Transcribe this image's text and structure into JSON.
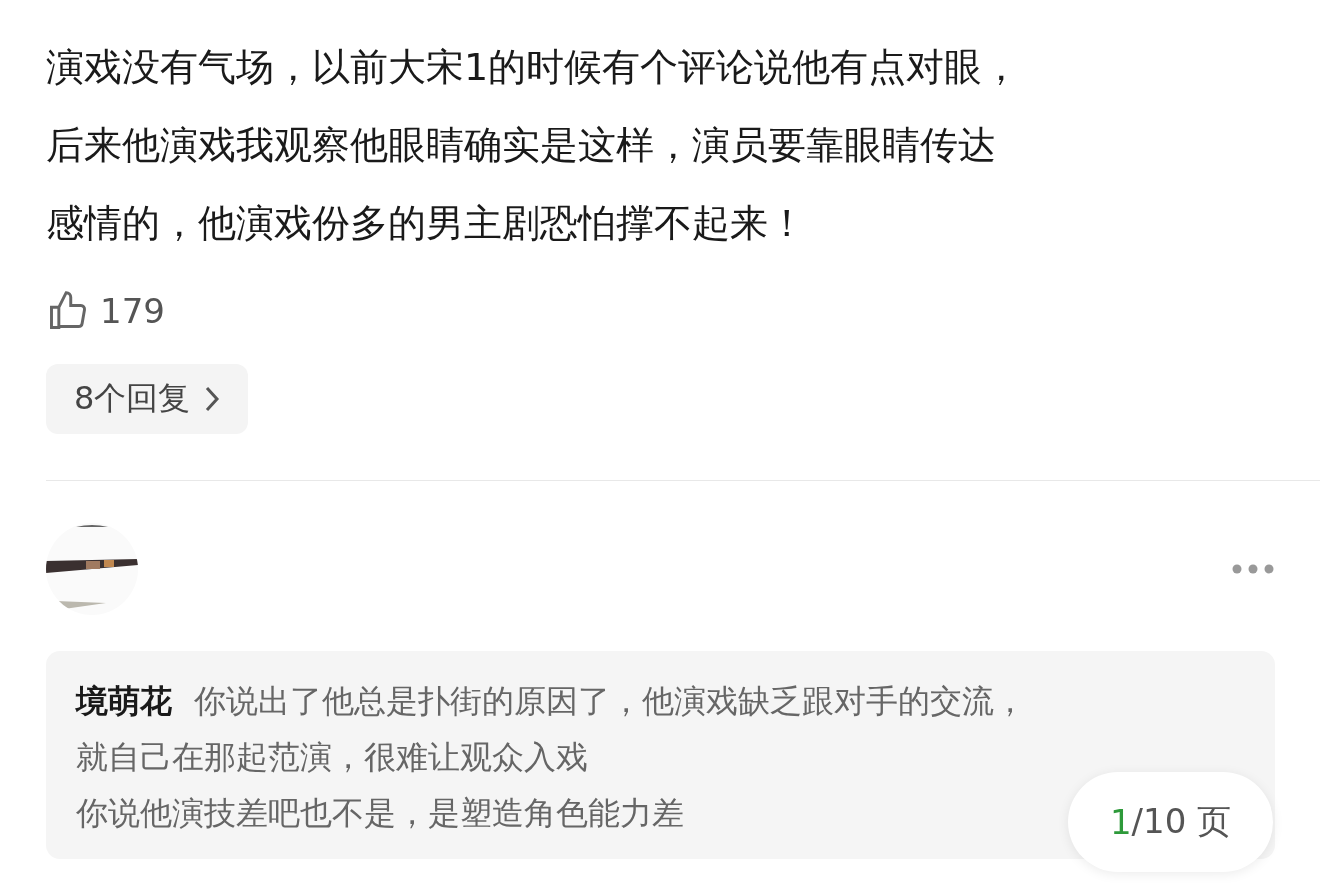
{
  "comment": {
    "lines": [
      "演戏没有气场，以前大宋1的时候有个评论说他有点对眼，",
      "后来他演戏我观察他眼睛确实是这样，演员要靠眼睛传达",
      "感情的，他演戏份多的男主剧恐怕撑不起来！"
    ],
    "likes": "179",
    "replies_button": "8个回复"
  },
  "reply": {
    "quote": {
      "author": "境萌花",
      "lines": [
        "你说出了他总是扑街的原因了，他演戏缺乏跟对手的交流，",
        "就自己在那起范演，很难让观众入戏",
        "你说他演技差吧也不是，是塑造角色能力差"
      ]
    }
  },
  "pager": {
    "current": "1",
    "rest": "/10 页"
  }
}
